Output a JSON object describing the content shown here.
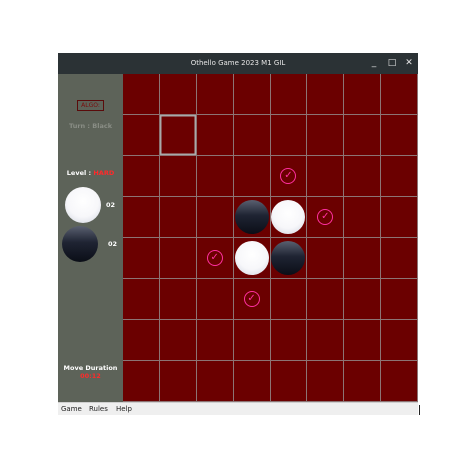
{
  "window": {
    "title": "Othello Game 2023 M1 GIL",
    "minimize_glyph": "_",
    "maximize_glyph": "□",
    "close_glyph": "✕"
  },
  "sidebar": {
    "algo_label": "ALGO:",
    "turn_text": "Turn : Black",
    "level_label": "Level :",
    "level_value": "HARD",
    "white_count": "02",
    "black_count": "02",
    "duration_label": "Move Duration",
    "duration_value": "00:12"
  },
  "board": {
    "size": 8,
    "highlighted_cell": [
      1,
      1
    ],
    "pieces": [
      {
        "row": 3,
        "col": 3,
        "color": "black"
      },
      {
        "row": 3,
        "col": 4,
        "color": "white"
      },
      {
        "row": 4,
        "col": 3,
        "color": "white"
      },
      {
        "row": 4,
        "col": 4,
        "color": "black"
      }
    ],
    "valid_moves": [
      {
        "row": 2,
        "col": 4
      },
      {
        "row": 3,
        "col": 5
      },
      {
        "row": 4,
        "col": 2
      },
      {
        "row": 5,
        "col": 3
      }
    ],
    "hint_glyph": "✓"
  },
  "menu": {
    "items": [
      "Game",
      "Rules",
      "Help"
    ]
  },
  "colors": {
    "board": "#6b0000",
    "panel": "#5d6359",
    "hint": "#ff2fa0",
    "accent_red": "#ff2a2a"
  }
}
